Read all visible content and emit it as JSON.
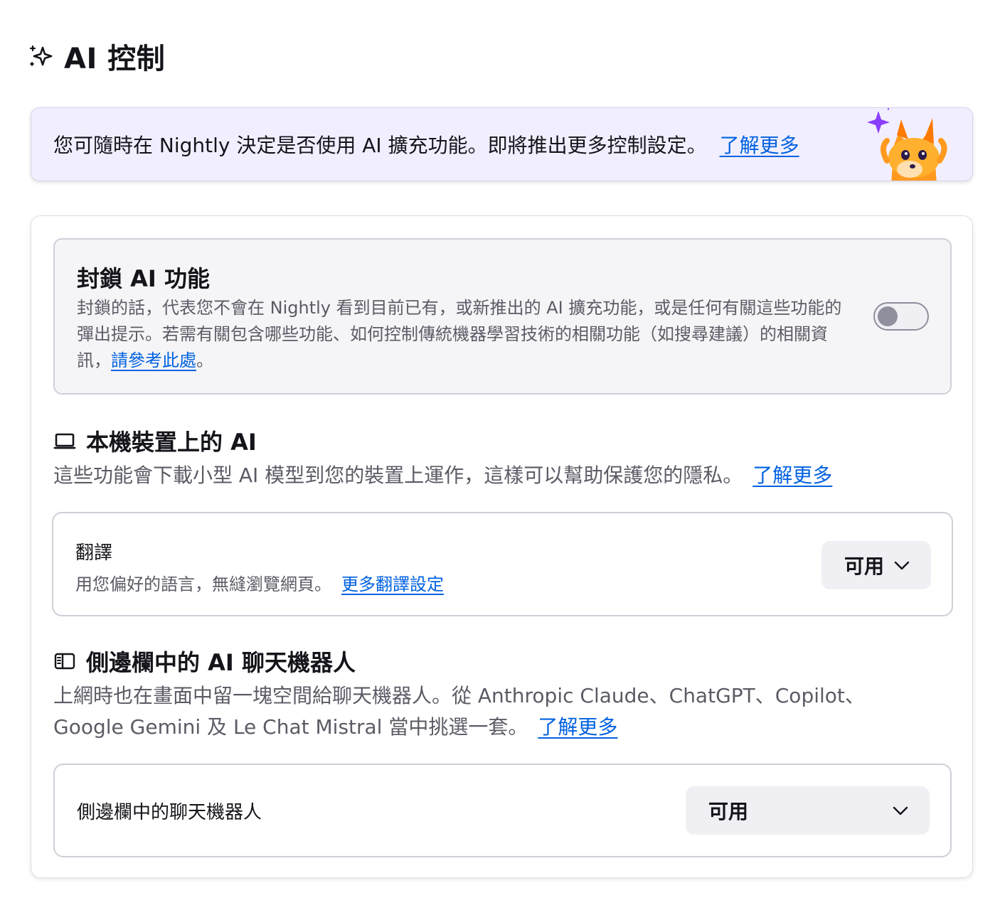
{
  "header": {
    "title": "AI 控制",
    "icon": "sparkle-icon"
  },
  "banner": {
    "text": "您可隨時在 Nightly 決定是否使用 AI 擴充功能。即將推出更多控制設定。",
    "link": "了解更多",
    "illustration": "fox-with-sparkles"
  },
  "block_ai": {
    "title": "封鎖 AI 功能",
    "description": "封鎖的話，代表您不會在 Nightly 看到目前已有，或新推出的 AI 擴充功能，或是任何有關這些功能的彈出提示。若需有關包含哪些功能、如何控制傳統機器學習技術的相關功能（如搜尋建議）的相關資訊，",
    "link": "請參考此處",
    "after_link": "。",
    "toggle_on": false
  },
  "local_ai": {
    "icon": "laptop-icon",
    "title": "本機裝置上的 AI",
    "description": "這些功能會下載小型 AI 模型到您的裝置上運作，這樣可以幫助保護您的隱私。",
    "link": "了解更多",
    "translation": {
      "name": "翻譯",
      "description": "用您偏好的語言，無縫瀏覽網頁。",
      "link": "更多翻譯設定",
      "select_value": "可用"
    }
  },
  "sidebar_chatbot": {
    "icon": "sidebar-icon",
    "title": "側邊欄中的 AI 聊天機器人",
    "description": "上網時也在畫面中留一塊空間給聊天機器人。從 Anthropic Claude、ChatGPT、Copilot、Google Gemini 及 Le Chat Mistral 當中挑選一套。",
    "link": "了解更多",
    "setting": {
      "name": "側邊欄中的聊天機器人",
      "select_value": "可用"
    }
  },
  "colors": {
    "accent_link": "#0061e0",
    "banner_bg": "#f1efff",
    "secondary_text": "#5b5b66"
  }
}
